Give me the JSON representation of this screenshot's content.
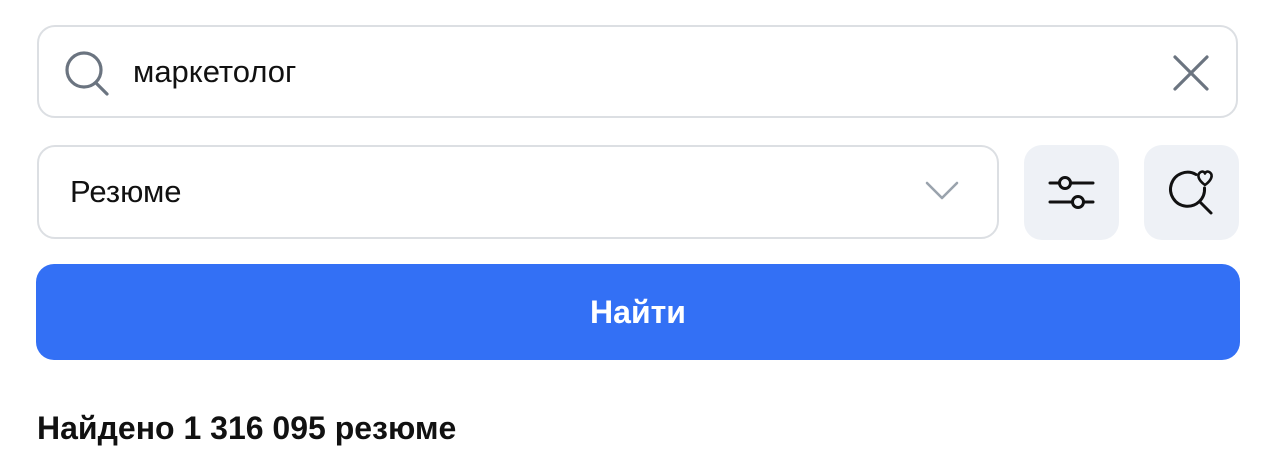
{
  "search": {
    "value": "маркетолог",
    "icon": "search-icon",
    "clear_icon": "close-icon"
  },
  "filter": {
    "selected": "Резюме",
    "chevron_icon": "chevron-down-icon"
  },
  "actions": {
    "filters_icon": "sliders-icon",
    "saved_search_icon": "search-heart-icon"
  },
  "find_button": {
    "label": "Найти"
  },
  "results": {
    "text": "Найдено 1 316 095 резюме"
  },
  "colors": {
    "accent": "#3370f5",
    "border": "#dcdfe3",
    "icon_button_bg": "#eef1f6"
  }
}
